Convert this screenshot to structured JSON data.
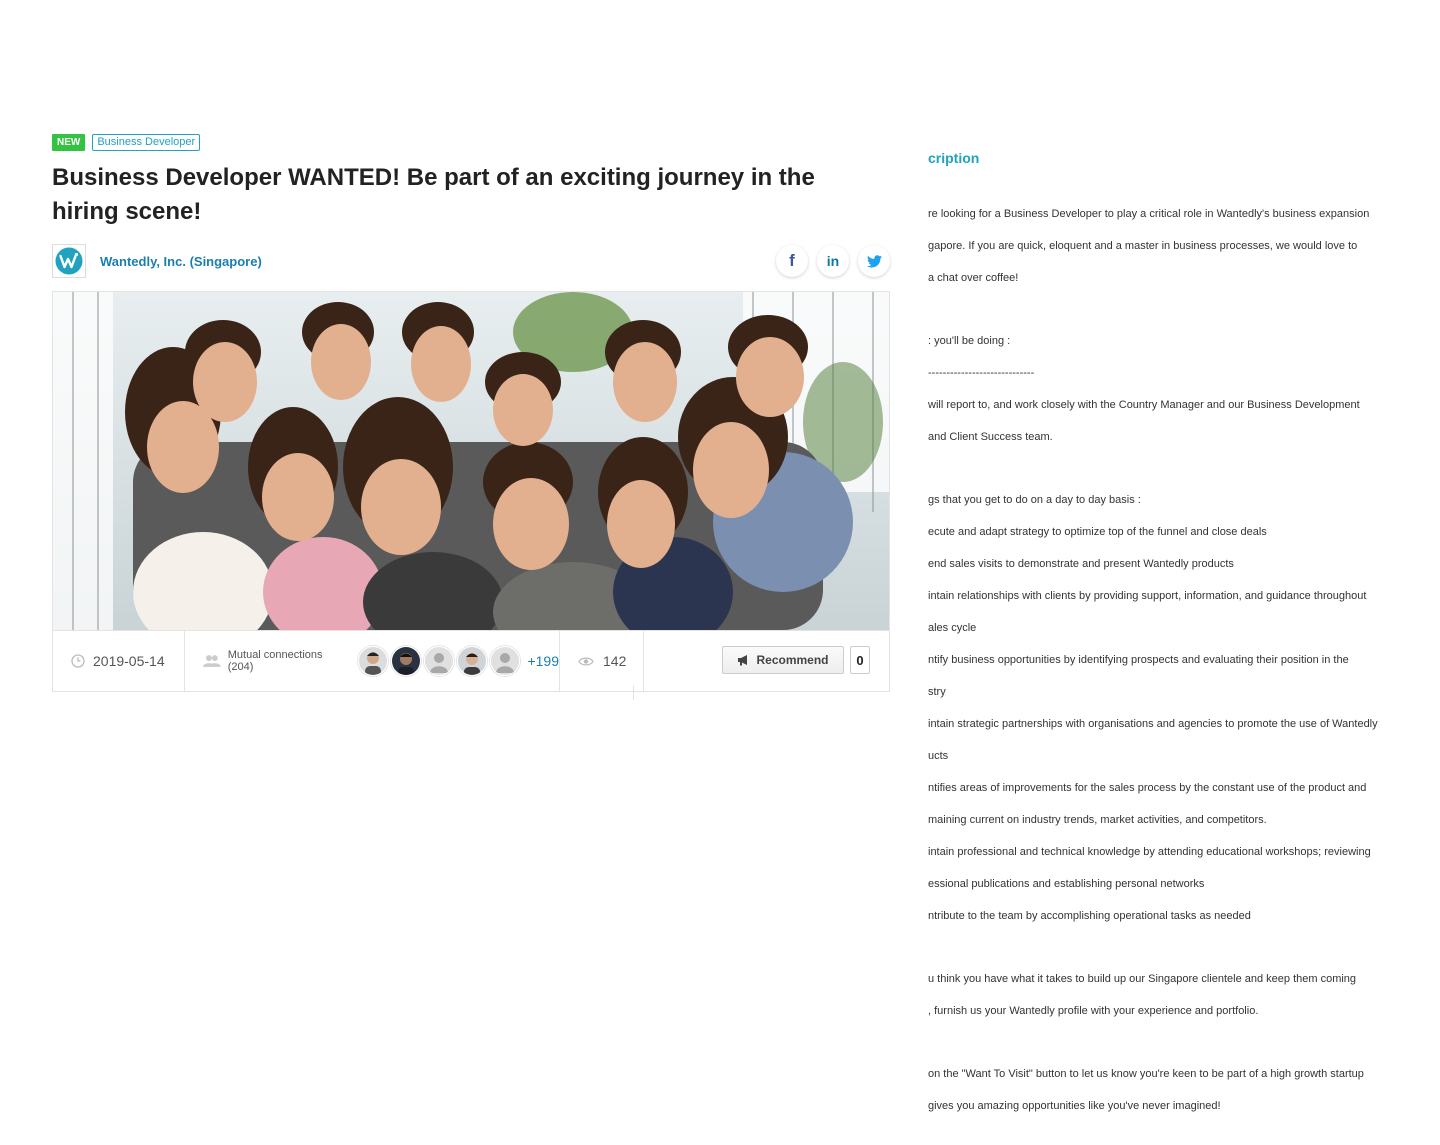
{
  "job": {
    "badge_new": "NEW",
    "tag_role": "Business Developer",
    "title": "Business Developer WANTED! Be part of an exciting journey in the hiring scene!",
    "company_name": "Wantedly, Inc. (Singapore)",
    "share": {
      "facebook": "f",
      "linkedin": "in"
    }
  },
  "footer": {
    "date": "2019-05-14",
    "mutual_label": "Mutual connections (204)",
    "mutual_more": "+199",
    "views": "142",
    "recommend_label": "Recommend",
    "recommend_count": "0"
  },
  "description": {
    "heading": "cription",
    "para1": [
      "re looking for a Business Developer to play a critical role in Wantedly's business expansion",
      "gapore. If you are quick, eloquent and a master in business processes, we would love to",
      "a chat over coffee!"
    ],
    "para2": [
      ": you'll be doing :",
      "-----------------------------",
      "will report to, and work closely with the Country Manager and our Business Development",
      "and Client Success team."
    ],
    "para3": [
      "gs that you get to do on a day to day basis :",
      "ecute and adapt strategy to optimize top of the funnel and close deals",
      "end sales visits to demonstrate and present Wantedly products",
      "intain relationships with clients by providing support, information, and guidance throughout",
      "ales cycle",
      "ntify business opportunities by identifying prospects and evaluating their position in the",
      "stry",
      "intain strategic partnerships with organisations and agencies to promote the use of Wantedly",
      "ucts",
      "ntifies areas of improvements for the sales process by the constant use of the product and",
      "maining current on industry trends, market activities, and competitors.",
      "intain professional and technical knowledge by attending educational workshops; reviewing",
      "essional publications and establishing personal networks",
      "ntribute to the team by accomplishing operational tasks as needed"
    ],
    "para4": [
      "u think you have what it takes to build up our Singapore clientele and keep them coming",
      ", furnish us your Wantedly profile with your experience and portfolio."
    ],
    "para5": [
      "on the \"Want To Visit\" button to let us know you're keen to be part of a high growth startup",
      "gives you amazing opportunities like you've never imagined!"
    ]
  },
  "colors": {
    "badge_new": "#33c241",
    "accent": "#21a2be",
    "link": "#1a7fae"
  }
}
